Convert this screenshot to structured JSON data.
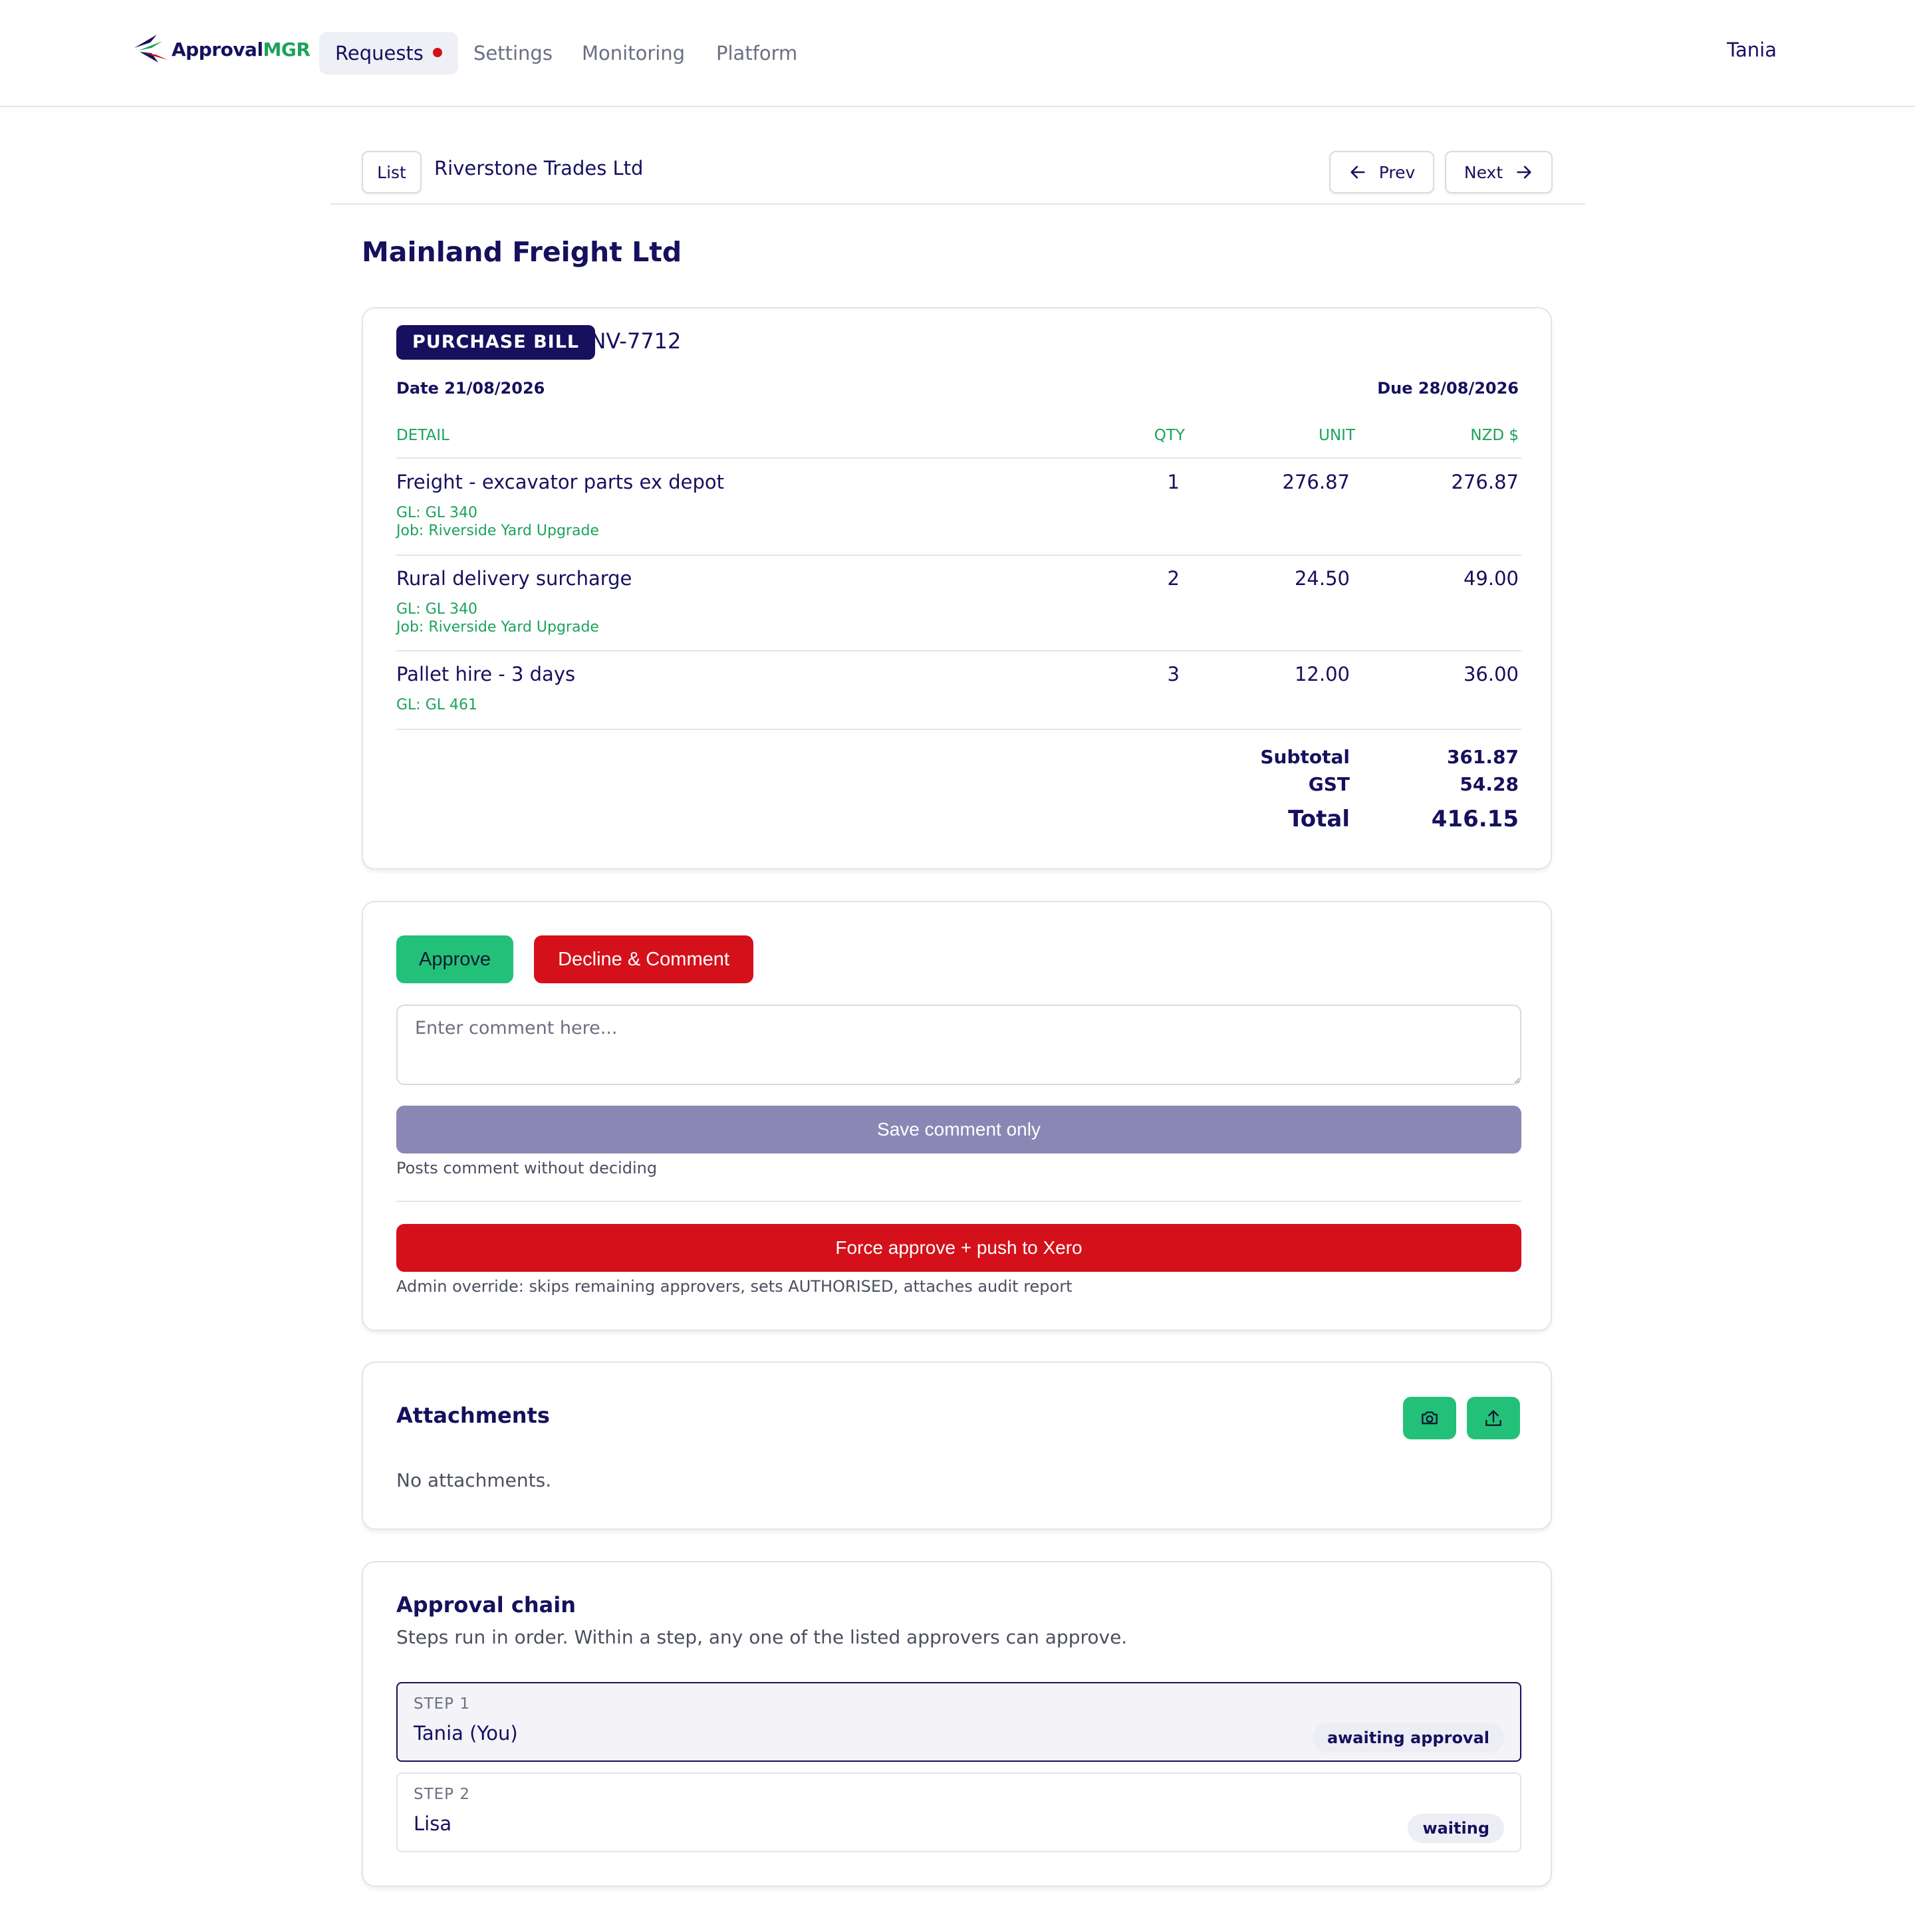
{
  "app": {
    "logo": {
      "part1": "Approval",
      "part2": "MGR"
    },
    "nav": [
      {
        "label": "Requests",
        "active": true,
        "has_notification": true
      },
      {
        "label": "Settings",
        "active": false
      },
      {
        "label": "Monitoring",
        "active": false
      },
      {
        "label": "Platform",
        "active": false
      }
    ],
    "user": "Tania"
  },
  "breadcrumb": {
    "list_label": "List",
    "current": "Riverstone Trades Ltd",
    "prev_label": "Prev",
    "next_label": "Next"
  },
  "page_title": "Mainland Freight Ltd",
  "bill": {
    "type_badge": "PURCHASE BILL",
    "number": "INV-7712",
    "date": "Date 21/08/2026",
    "due": "Due 28/08/2026",
    "columns": {
      "detail": "DETAIL",
      "qty": "QTY",
      "unit": "UNIT",
      "amount": "NZD $"
    },
    "lines": [
      {
        "description": "Freight - excavator parts ex depot",
        "gl": "GL: GL 340",
        "job": "Job: Riverside Yard Upgrade",
        "qty": "1",
        "unit": "276.87",
        "amount": "276.87"
      },
      {
        "description": "Rural delivery surcharge",
        "gl": "GL: GL 340",
        "job": "Job: Riverside Yard Upgrade",
        "qty": "2",
        "unit": "24.50",
        "amount": "49.00"
      },
      {
        "description": "Pallet hire - 3 days",
        "gl": "GL: GL 461",
        "qty": "3",
        "unit": "12.00",
        "amount": "36.00"
      }
    ],
    "subtotal_label": "Subtotal",
    "subtotal": "361.87",
    "tax_label": "GST",
    "tax": "54.28",
    "total_label": "Total",
    "total": "416.15"
  },
  "actions": {
    "approve_label": "Approve",
    "decline_label": "Decline & Comment",
    "comment_placeholder": "Enter comment here...",
    "save_label": "Save comment only",
    "save_hint": "Posts comment without deciding",
    "force_label": "Force approve + push to Xero",
    "force_hint": "Admin override: skips remaining approvers, sets AUTHORISED, attaches audit report"
  },
  "attachments": {
    "title": "Attachments",
    "empty_text": "No attachments.",
    "camera_icon": "camera-icon",
    "upload_icon": "upload-icon"
  },
  "approval_chain": {
    "title": "Approval chain",
    "subtitle": "Steps run in order. Within a step, any one of the listed approvers can approve.",
    "steps": [
      {
        "label": "STEP 1",
        "approver": "Tania (You)",
        "status": "awaiting approval",
        "current": true
      },
      {
        "label": "STEP 2",
        "approver": "Lisa",
        "status": "waiting",
        "current": false
      }
    ]
  },
  "colors": {
    "navy": "#16105e",
    "green": "#23c07a",
    "green_text": "#1aa35a",
    "red": "#d4111a",
    "muted_purple": "#8b87b5"
  }
}
